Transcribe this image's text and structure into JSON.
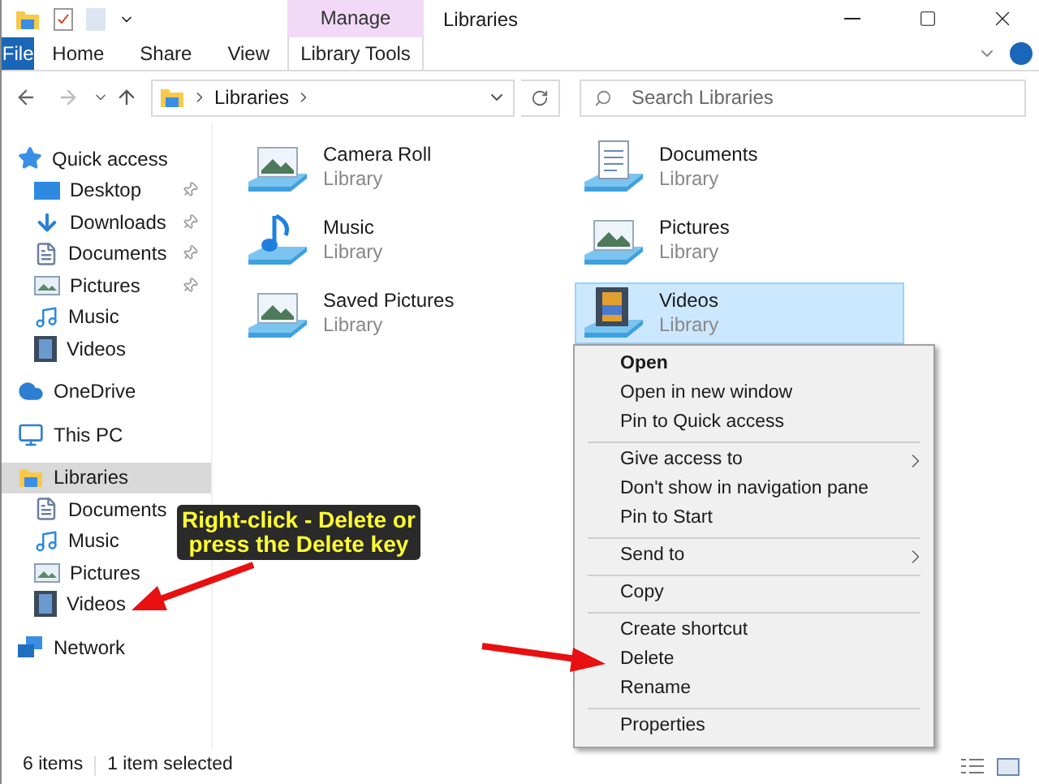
{
  "window": {
    "title": "Libraries"
  },
  "ribbon": {
    "context_group": "Manage",
    "tabs": [
      {
        "label": "File",
        "kind": "file"
      },
      {
        "label": "Home",
        "kind": "tab"
      },
      {
        "label": "Share",
        "kind": "tab"
      },
      {
        "label": "View",
        "kind": "tab"
      },
      {
        "label": "Library Tools",
        "kind": "context"
      }
    ]
  },
  "address": {
    "path": "Libraries",
    "search_placeholder": "Search Libraries"
  },
  "navigation": [
    {
      "label": "Quick access",
      "kind": "quick_access",
      "selected": false,
      "children": [
        {
          "label": "Desktop",
          "kind": "desktop",
          "pinned": true,
          "selected": false
        },
        {
          "label": "Downloads",
          "kind": "downloads",
          "pinned": true,
          "selected": false
        },
        {
          "label": "Documents",
          "kind": "documents",
          "pinned": true,
          "selected": false
        },
        {
          "label": "Pictures",
          "kind": "pictures",
          "pinned": true,
          "selected": false
        },
        {
          "label": "Music",
          "kind": "music",
          "pinned": false,
          "selected": false
        },
        {
          "label": "Videos",
          "kind": "videos",
          "pinned": false,
          "selected": false
        }
      ]
    },
    {
      "label": "OneDrive",
      "kind": "cloud",
      "selected": false
    },
    {
      "label": "This PC",
      "kind": "pc",
      "selected": false
    },
    {
      "label": "Libraries",
      "kind": "libraries",
      "selected": true,
      "children": [
        {
          "label": "Documents",
          "kind": "documents",
          "pinned": false,
          "selected": false
        },
        {
          "label": "Music",
          "kind": "music",
          "pinned": false,
          "selected": false
        },
        {
          "label": "Pictures",
          "kind": "pictures",
          "pinned": false,
          "selected": false
        },
        {
          "label": "Videos",
          "kind": "videos",
          "pinned": false,
          "selected": false
        }
      ]
    },
    {
      "label": "Network",
      "kind": "network",
      "selected": false
    }
  ],
  "items": [
    {
      "name": "Camera Roll",
      "type": "Library",
      "kind": "pictures",
      "selected": false
    },
    {
      "name": "Documents",
      "type": "Library",
      "kind": "documents",
      "selected": false
    },
    {
      "name": "Music",
      "type": "Library",
      "kind": "music",
      "selected": false
    },
    {
      "name": "Pictures",
      "type": "Library",
      "kind": "pictures",
      "selected": false
    },
    {
      "name": "Saved Pictures",
      "type": "Library",
      "kind": "pictures",
      "selected": false
    },
    {
      "name": "Videos",
      "type": "Library",
      "kind": "videos",
      "selected": true
    }
  ],
  "context_menu": [
    [
      {
        "label": "Open",
        "default": true,
        "submenu": false
      },
      {
        "label": "Open in new window",
        "default": false,
        "submenu": false
      },
      {
        "label": "Pin to Quick access",
        "default": false,
        "submenu": false
      }
    ],
    [
      {
        "label": "Give access to",
        "default": false,
        "submenu": true
      },
      {
        "label": "Don't show in navigation pane",
        "default": false,
        "submenu": false
      },
      {
        "label": "Pin to Start",
        "default": false,
        "submenu": false
      }
    ],
    [
      {
        "label": "Send to",
        "default": false,
        "submenu": true
      }
    ],
    [
      {
        "label": "Copy",
        "default": false,
        "submenu": false
      }
    ],
    [
      {
        "label": "Create shortcut",
        "default": false,
        "submenu": false
      },
      {
        "label": "Delete",
        "default": false,
        "submenu": false
      },
      {
        "label": "Rename",
        "default": false,
        "submenu": false
      }
    ],
    [
      {
        "label": "Properties",
        "default": false,
        "submenu": false
      }
    ]
  ],
  "annotation": {
    "lines": [
      "Right-click - Delete or",
      "press the Delete key"
    ]
  },
  "status_bar": {
    "count": "6 items",
    "selection": "1 item selected"
  }
}
